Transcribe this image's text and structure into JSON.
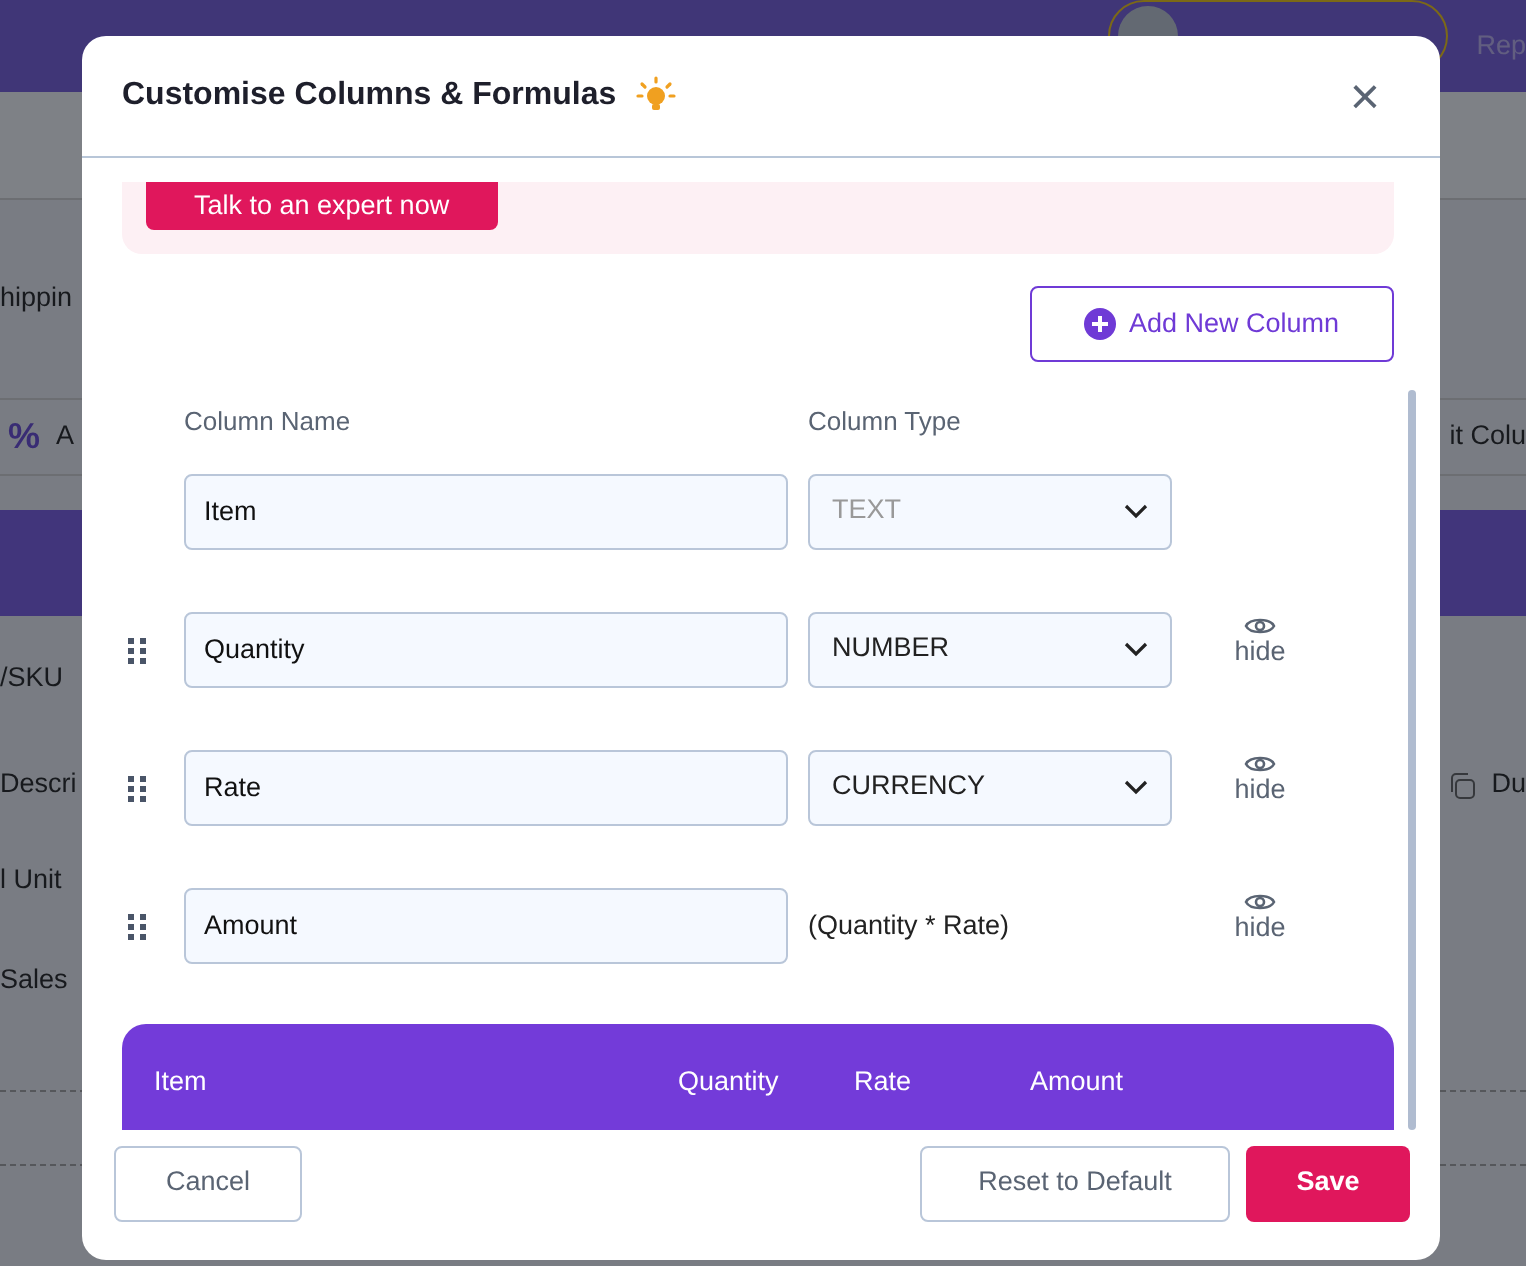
{
  "background": {
    "nav_link": "Rep",
    "rows": [
      {
        "kind": "blank"
      },
      {
        "kind": "text",
        "left": "hippin"
      },
      {
        "kind": "toolbar",
        "left_symbol": "%",
        "left": "A",
        "right": "it Colu"
      },
      {
        "kind": "band"
      },
      {
        "kind": "field",
        "left": "/SKU"
      },
      {
        "kind": "action",
        "left": "Descri",
        "right": "Du"
      },
      {
        "kind": "text",
        "left": "l Unit"
      },
      {
        "kind": "text",
        "left": "Sales"
      },
      {
        "kind": "dashed"
      }
    ]
  },
  "modal": {
    "title": "Customise Columns & Formulas",
    "close": "×",
    "alert_button": "Talk to an expert now",
    "add_button": "Add New Column",
    "headers": [
      "Column Name",
      "Column Type"
    ],
    "columns": [
      {
        "kind": "fixed",
        "name": "Item",
        "type": "TEXT",
        "disabled": true
      },
      {
        "kind": "select",
        "name": "Quantity",
        "type": "NUMBER",
        "disabled": false,
        "hide_label": "hide"
      },
      {
        "kind": "select",
        "name": "Rate",
        "type": "CURRENCY",
        "disabled": false,
        "hide_label": "hide"
      },
      {
        "kind": "formula",
        "name": "Amount",
        "formula": "(Quantity * Rate)",
        "hide_label": "hide"
      }
    ],
    "preview_columns": [
      "Item",
      "Quantity",
      "Rate",
      "Amount"
    ],
    "footer": {
      "cancel": "Cancel",
      "reset": "Reset to Default",
      "save": "Save"
    }
  }
}
